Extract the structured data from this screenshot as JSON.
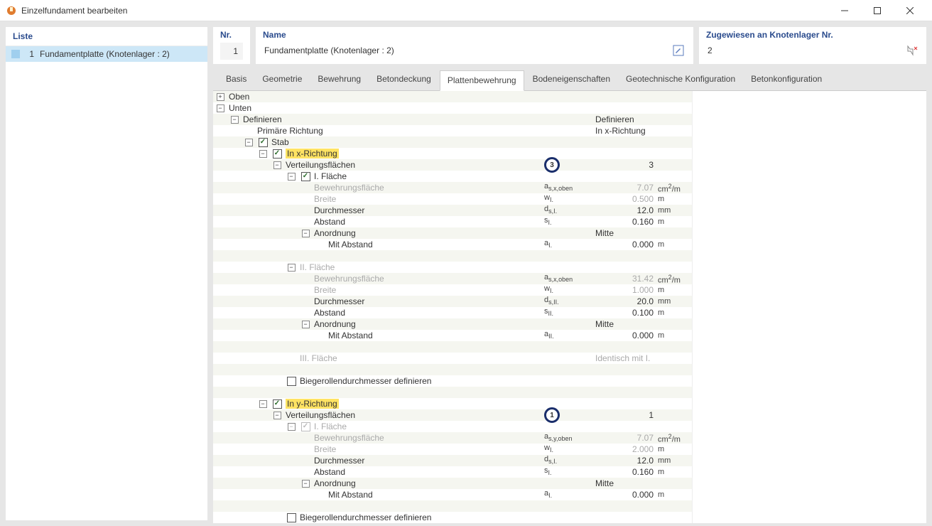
{
  "window": {
    "title": "Einzelfundament bearbeiten"
  },
  "left": {
    "header": "Liste",
    "item_num": "1",
    "item_label": "Fundamentplatte (Knotenlager : 2)"
  },
  "top": {
    "nr_label": "Nr.",
    "nr_value": "1",
    "name_label": "Name",
    "name_value": "Fundamentplatte (Knotenlager : 2)",
    "assign_label": "Zugewiesen an Knotenlager Nr.",
    "assign_value": "2"
  },
  "tabs": {
    "t0": "Basis",
    "t1": "Geometrie",
    "t2": "Bewehrung",
    "t3": "Betondeckung",
    "t4": "Plattenbewehrung",
    "t5": "Bodeneigenschaften",
    "t6": "Geotechnische Konfiguration",
    "t7": "Betonkonfiguration"
  },
  "tree": {
    "oben": "Oben",
    "unten": "Unten",
    "definieren": "Definieren",
    "definieren_val": "Definieren",
    "primaere": "Primäre Richtung",
    "primaere_val": "In x-Richtung",
    "stab": "Stab",
    "in_x": "In x-Richtung",
    "verteil": "Verteilungsflächen",
    "verteil_val_x": "3",
    "i_flaeche": "I. Fläche",
    "bewfl": "Bewehrungsfläche",
    "breite": "Breite",
    "durchmesser": "Durchmesser",
    "abstand": "Abstand",
    "anordnung": "Anordnung",
    "anordnung_val": "Mitte",
    "mit_abstand": "Mit Abstand",
    "ii_flaeche": "II. Fläche",
    "iii_flaeche": "III. Fläche",
    "iii_val": "Identisch mit I.",
    "biegeroll": "Biegerollendurchmesser definieren",
    "in_y": "In y-Richtung",
    "verteil_val_y": "1",
    "sym": {
      "asx": "as,x,oben",
      "wi": "wI.",
      "dsi": "ds,I.",
      "si": "sI.",
      "ai": "aI.",
      "dsii": "ds,II.",
      "sii": "sII.",
      "aii": "aII.",
      "asy": "as,y,oben"
    },
    "vals": {
      "x_i_as": "7.07",
      "x_i_w": "0.500",
      "x_i_d": "12.0",
      "x_i_s": "0.160",
      "x_i_a": "0.000",
      "x_ii_as": "31.42",
      "x_ii_w": "1.000",
      "x_ii_d": "20.0",
      "x_ii_s": "0.100",
      "x_ii_a": "0.000",
      "y_i_as": "7.07",
      "y_i_w": "2.000",
      "y_i_d": "12.0",
      "y_i_s": "0.160",
      "y_i_a": "0.000"
    },
    "units": {
      "cm2m": "cm²/m",
      "m": "m",
      "mm": "mm"
    },
    "markers": {
      "x": "3",
      "y": "1"
    }
  }
}
